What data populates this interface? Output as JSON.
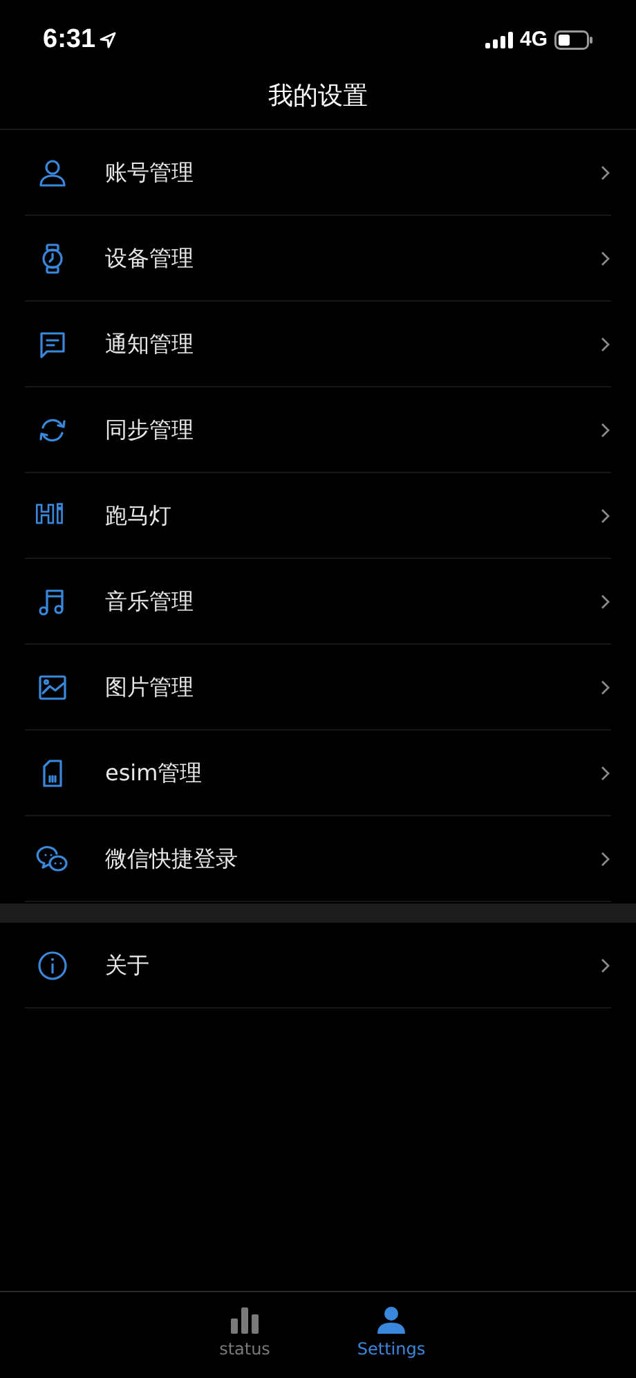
{
  "status_bar": {
    "time": "6:31",
    "network": "4G"
  },
  "header": {
    "title": "我的设置"
  },
  "sections": [
    {
      "items": [
        {
          "label": "账号管理"
        },
        {
          "label": "设备管理"
        },
        {
          "label": "通知管理"
        },
        {
          "label": "同步管理"
        },
        {
          "logo_text": "Hi",
          "label": "跑马灯"
        },
        {
          "label": "音乐管理"
        },
        {
          "label": "图片管理"
        },
        {
          "label": "esim管理"
        },
        {
          "label": "微信快捷登录"
        }
      ]
    },
    {
      "items": [
        {
          "label": "关于"
        }
      ]
    }
  ],
  "tab_bar": [
    {
      "label": "status",
      "selected": false
    },
    {
      "label": "Settings",
      "selected": true
    }
  ]
}
